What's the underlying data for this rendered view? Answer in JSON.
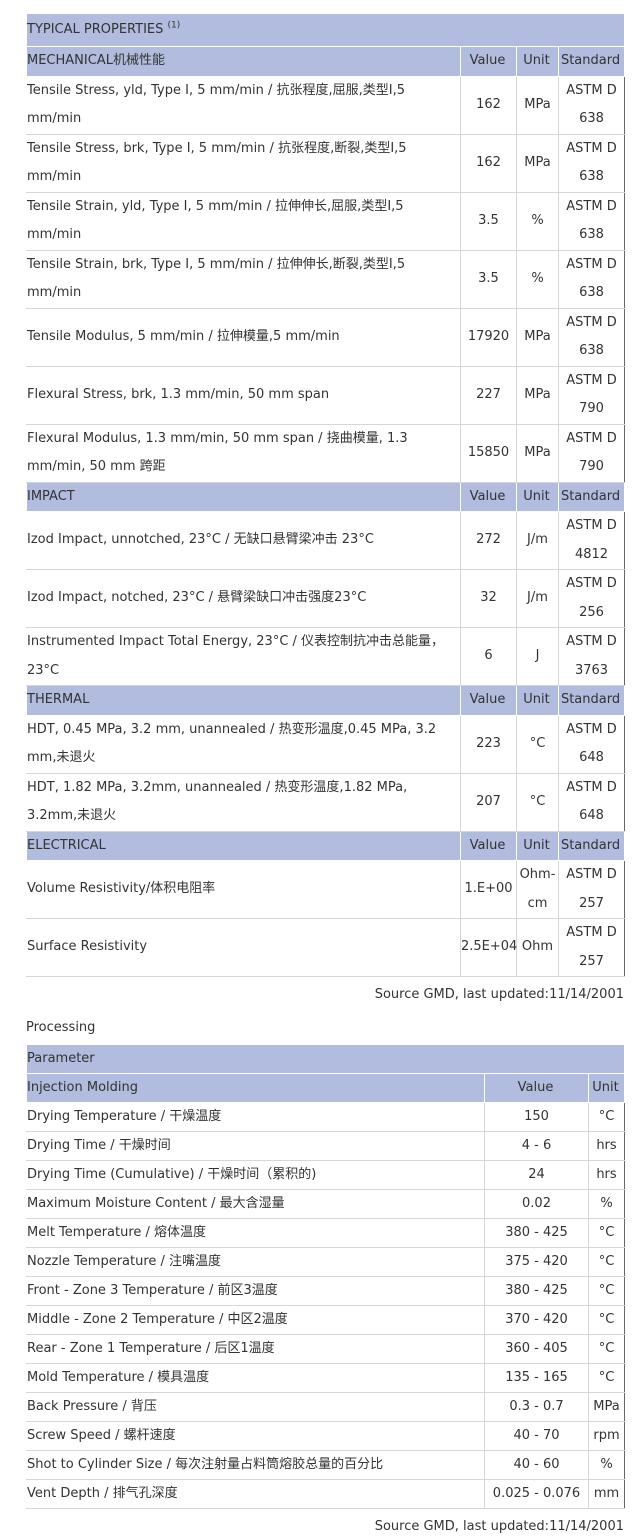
{
  "props": {
    "title": "TYPICAL PROPERTIES",
    "title_note": "(1)",
    "sections": [
      {
        "name": "MECHANICAL机械性能",
        "value_hdr": "Value",
        "unit_hdr": "Unit",
        "std_hdr": "Standard",
        "rows": [
          {
            "prop": "Tensile Stress, yld, Type I, 5 mm/min / 抗张程度,屈服,类型I,5 mm/min",
            "value": "162",
            "unit": "MPa",
            "std": "ASTM D 638"
          },
          {
            "prop": "Tensile Stress, brk, Type I, 5 mm/min / 抗张程度,断裂,类型I,5 mm/min",
            "value": "162",
            "unit": "MPa",
            "std": "ASTM D 638"
          },
          {
            "prop": "Tensile Strain, yld, Type I, 5 mm/min / 拉伸伸长,屈服,类型I,5 mm/min",
            "value": "3.5",
            "unit": "%",
            "std": "ASTM D 638"
          },
          {
            "prop": "Tensile Strain, brk, Type I, 5 mm/min / 拉伸伸长,断裂,类型I,5 mm/min",
            "value": "3.5",
            "unit": "%",
            "std": "ASTM D 638"
          },
          {
            "prop": "Tensile Modulus, 5 mm/min / 拉伸模量,5 mm/min",
            "value": "17920",
            "unit": "MPa",
            "std": "ASTM D 638"
          },
          {
            "prop": "Flexural Stress, brk, 1.3 mm/min, 50 mm span",
            "value": "227",
            "unit": "MPa",
            "std": "ASTM D 790"
          },
          {
            "prop": "Flexural Modulus, 1.3 mm/min, 50 mm span / 挠曲模量, 1.3 mm/min, 50 mm 跨距",
            "value": "15850",
            "unit": "MPa",
            "std": "ASTM D 790"
          }
        ]
      },
      {
        "name": "IMPACT",
        "value_hdr": "Value",
        "unit_hdr": "Unit",
        "std_hdr": "Standard",
        "rows": [
          {
            "prop": "Izod Impact, unnotched, 23°C / 无缺口悬臂梁冲击 23°C",
            "value": "272",
            "unit": "J/m",
            "std": "ASTM D 4812"
          },
          {
            "prop": "Izod Impact, notched, 23°C / 悬臂梁缺口冲击强度23°C",
            "value": "32",
            "unit": "J/m",
            "std": "ASTM D 256"
          },
          {
            "prop": "Instrumented Impact Total Energy, 23°C / 仪表控制抗冲击总能量，23°C",
            "value": "6",
            "unit": "J",
            "std": "ASTM D 3763"
          }
        ]
      },
      {
        "name": "THERMAL",
        "value_hdr": "Value",
        "unit_hdr": "Unit",
        "std_hdr": "Standard",
        "rows": [
          {
            "prop": "HDT, 0.45 MPa, 3.2 mm, unannealed / 热变形温度,0.45 MPa, 3.2 mm,未退火",
            "value": "223",
            "unit": "°C",
            "std": "ASTM D 648"
          },
          {
            "prop": "HDT, 1.82 MPa, 3.2mm, unannealed / 热变形温度,1.82 MPa, 3.2mm,未退火",
            "value": "207",
            "unit": "°C",
            "std": "ASTM D 648"
          }
        ]
      },
      {
        "name": "ELECTRICAL",
        "value_hdr": "Value",
        "unit_hdr": "Unit",
        "std_hdr": "Standard",
        "rows": [
          {
            "prop": "Volume Resistivity/体积电阻率",
            "value": "1.E+00",
            "unit": "Ohm-cm",
            "std": "ASTM D 257"
          },
          {
            "prop": "Surface Resistivity",
            "value": "2.5E+04",
            "unit": "Ohm",
            "std": "ASTM D 257"
          }
        ]
      }
    ],
    "source": "Source GMD, last updated:11/14/2001"
  },
  "processing": {
    "label": "Processing",
    "param_hdr": "Parameter",
    "section": "Injection Molding",
    "value_hdr": "Value",
    "unit_hdr": "Unit",
    "rows": [
      {
        "param": "Drying Temperature / 干燥温度",
        "value": "150",
        "unit": "°C"
      },
      {
        "param": "Drying Time / 干燥时间",
        "value": "4 - 6",
        "unit": "hrs"
      },
      {
        "param": "Drying Time (Cumulative) / 干燥时间（累积的)",
        "value": "24",
        "unit": "hrs"
      },
      {
        "param": "Maximum Moisture Content / 最大含湿量",
        "value": "0.02",
        "unit": "%"
      },
      {
        "param": "Melt Temperature / 熔体温度",
        "value": "380 - 425",
        "unit": "°C"
      },
      {
        "param": "Nozzle Temperature / 注嘴温度",
        "value": "375 - 420",
        "unit": "°C"
      },
      {
        "param": "Front - Zone 3 Temperature / 前区3温度",
        "value": "380 - 425",
        "unit": "°C"
      },
      {
        "param": "Middle - Zone 2 Temperature / 中区2温度",
        "value": "370 - 420",
        "unit": "°C"
      },
      {
        "param": "Rear - Zone 1 Temperature / 后区1温度",
        "value": "360 - 405",
        "unit": "°C"
      },
      {
        "param": "Mold Temperature / 模具温度",
        "value": "135 - 165",
        "unit": "°C"
      },
      {
        "param": "Back Pressure / 背压",
        "value": "0.3 - 0.7",
        "unit": "MPa"
      },
      {
        "param": "Screw Speed / 螺杆速度",
        "value": "40 - 70",
        "unit": "rpm"
      },
      {
        "param": "Shot to Cylinder Size / 每次注射量占料筒熔胶总量的百分比",
        "value": "40 - 60",
        "unit": "%"
      },
      {
        "param": "Vent Depth / 排气孔深度",
        "value": "0.025 - 0.076",
        "unit": "mm"
      }
    ],
    "source": "Source GMD, last updated:11/14/2001"
  }
}
